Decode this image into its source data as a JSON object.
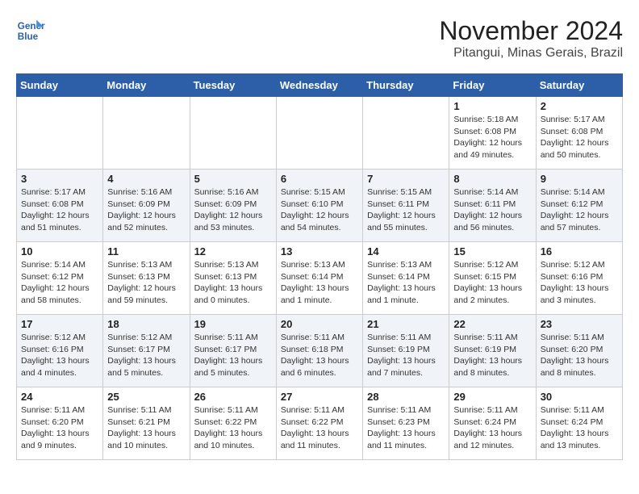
{
  "header": {
    "logo_line1": "General",
    "logo_line2": "Blue",
    "main_title": "November 2024",
    "subtitle": "Pitangui, Minas Gerais, Brazil"
  },
  "calendar": {
    "days_of_week": [
      "Sunday",
      "Monday",
      "Tuesday",
      "Wednesday",
      "Thursday",
      "Friday",
      "Saturday"
    ],
    "weeks": [
      [
        {
          "day": "",
          "info": ""
        },
        {
          "day": "",
          "info": ""
        },
        {
          "day": "",
          "info": ""
        },
        {
          "day": "",
          "info": ""
        },
        {
          "day": "",
          "info": ""
        },
        {
          "day": "1",
          "info": "Sunrise: 5:18 AM\nSunset: 6:08 PM\nDaylight: 12 hours\nand 49 minutes."
        },
        {
          "day": "2",
          "info": "Sunrise: 5:17 AM\nSunset: 6:08 PM\nDaylight: 12 hours\nand 50 minutes."
        }
      ],
      [
        {
          "day": "3",
          "info": "Sunrise: 5:17 AM\nSunset: 6:08 PM\nDaylight: 12 hours\nand 51 minutes."
        },
        {
          "day": "4",
          "info": "Sunrise: 5:16 AM\nSunset: 6:09 PM\nDaylight: 12 hours\nand 52 minutes."
        },
        {
          "day": "5",
          "info": "Sunrise: 5:16 AM\nSunset: 6:09 PM\nDaylight: 12 hours\nand 53 minutes."
        },
        {
          "day": "6",
          "info": "Sunrise: 5:15 AM\nSunset: 6:10 PM\nDaylight: 12 hours\nand 54 minutes."
        },
        {
          "day": "7",
          "info": "Sunrise: 5:15 AM\nSunset: 6:11 PM\nDaylight: 12 hours\nand 55 minutes."
        },
        {
          "day": "8",
          "info": "Sunrise: 5:14 AM\nSunset: 6:11 PM\nDaylight: 12 hours\nand 56 minutes."
        },
        {
          "day": "9",
          "info": "Sunrise: 5:14 AM\nSunset: 6:12 PM\nDaylight: 12 hours\nand 57 minutes."
        }
      ],
      [
        {
          "day": "10",
          "info": "Sunrise: 5:14 AM\nSunset: 6:12 PM\nDaylight: 12 hours\nand 58 minutes."
        },
        {
          "day": "11",
          "info": "Sunrise: 5:13 AM\nSunset: 6:13 PM\nDaylight: 12 hours\nand 59 minutes."
        },
        {
          "day": "12",
          "info": "Sunrise: 5:13 AM\nSunset: 6:13 PM\nDaylight: 13 hours\nand 0 minutes."
        },
        {
          "day": "13",
          "info": "Sunrise: 5:13 AM\nSunset: 6:14 PM\nDaylight: 13 hours\nand 1 minute."
        },
        {
          "day": "14",
          "info": "Sunrise: 5:13 AM\nSunset: 6:14 PM\nDaylight: 13 hours\nand 1 minute."
        },
        {
          "day": "15",
          "info": "Sunrise: 5:12 AM\nSunset: 6:15 PM\nDaylight: 13 hours\nand 2 minutes."
        },
        {
          "day": "16",
          "info": "Sunrise: 5:12 AM\nSunset: 6:16 PM\nDaylight: 13 hours\nand 3 minutes."
        }
      ],
      [
        {
          "day": "17",
          "info": "Sunrise: 5:12 AM\nSunset: 6:16 PM\nDaylight: 13 hours\nand 4 minutes."
        },
        {
          "day": "18",
          "info": "Sunrise: 5:12 AM\nSunset: 6:17 PM\nDaylight: 13 hours\nand 5 minutes."
        },
        {
          "day": "19",
          "info": "Sunrise: 5:11 AM\nSunset: 6:17 PM\nDaylight: 13 hours\nand 5 minutes."
        },
        {
          "day": "20",
          "info": "Sunrise: 5:11 AM\nSunset: 6:18 PM\nDaylight: 13 hours\nand 6 minutes."
        },
        {
          "day": "21",
          "info": "Sunrise: 5:11 AM\nSunset: 6:19 PM\nDaylight: 13 hours\nand 7 minutes."
        },
        {
          "day": "22",
          "info": "Sunrise: 5:11 AM\nSunset: 6:19 PM\nDaylight: 13 hours\nand 8 minutes."
        },
        {
          "day": "23",
          "info": "Sunrise: 5:11 AM\nSunset: 6:20 PM\nDaylight: 13 hours\nand 8 minutes."
        }
      ],
      [
        {
          "day": "24",
          "info": "Sunrise: 5:11 AM\nSunset: 6:20 PM\nDaylight: 13 hours\nand 9 minutes."
        },
        {
          "day": "25",
          "info": "Sunrise: 5:11 AM\nSunset: 6:21 PM\nDaylight: 13 hours\nand 10 minutes."
        },
        {
          "day": "26",
          "info": "Sunrise: 5:11 AM\nSunset: 6:22 PM\nDaylight: 13 hours\nand 10 minutes."
        },
        {
          "day": "27",
          "info": "Sunrise: 5:11 AM\nSunset: 6:22 PM\nDaylight: 13 hours\nand 11 minutes."
        },
        {
          "day": "28",
          "info": "Sunrise: 5:11 AM\nSunset: 6:23 PM\nDaylight: 13 hours\nand 11 minutes."
        },
        {
          "day": "29",
          "info": "Sunrise: 5:11 AM\nSunset: 6:24 PM\nDaylight: 13 hours\nand 12 minutes."
        },
        {
          "day": "30",
          "info": "Sunrise: 5:11 AM\nSunset: 6:24 PM\nDaylight: 13 hours\nand 13 minutes."
        }
      ]
    ]
  }
}
